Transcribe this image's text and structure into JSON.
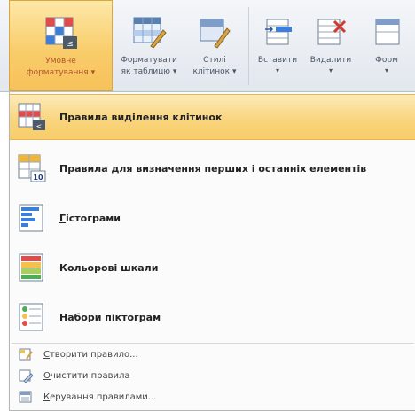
{
  "ribbon": {
    "buttons": [
      {
        "line1": "Умовне",
        "line2": "форматування",
        "arrow": "▾"
      },
      {
        "line1": "Форматувати",
        "line2": "як таблицю",
        "arrow": "▾"
      },
      {
        "line1": "Стилі",
        "line2": "клітинок",
        "arrow": "▾"
      },
      {
        "line1": "Вставити",
        "line2": "",
        "arrow": "▾"
      },
      {
        "line1": "Видалити",
        "line2": "",
        "arrow": "▾"
      },
      {
        "line1": "Форм",
        "line2": "",
        "arrow": "▾"
      }
    ]
  },
  "menu": {
    "items": [
      {
        "label": "Правила виділення клітинок"
      },
      {
        "label": "Правила для визначення перших і останніх елементів"
      },
      {
        "label_first": "Г",
        "label_rest": "істограми"
      },
      {
        "label": "Кольорові шкали"
      },
      {
        "label": "Набори піктограм"
      }
    ],
    "small_items": [
      {
        "label_first": "С",
        "label_rest": "творити правило..."
      },
      {
        "label_first": "О",
        "label_rest": "чистити правила"
      },
      {
        "label_first": "К",
        "label_rest": "ерування правилами..."
      }
    ]
  },
  "colors": {
    "accent": "#f9cd6c",
    "ribbon_bg": "#e8ecf1"
  }
}
